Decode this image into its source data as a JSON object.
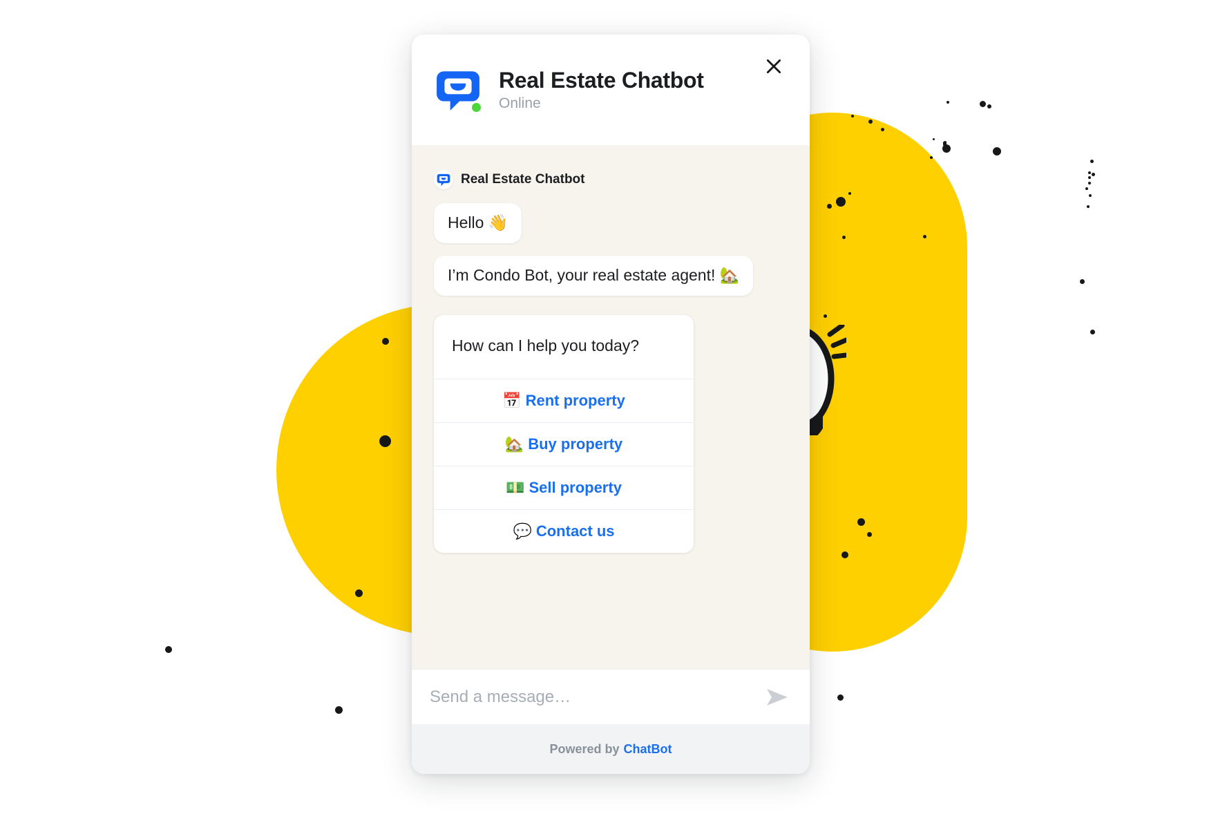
{
  "widget": {
    "header": {
      "title": "Real Estate Chatbot",
      "status": "Online",
      "avatar_icon": "chatbot-logo-icon",
      "close_icon": "close-icon",
      "online_indicator_color": "#4CD738"
    },
    "conversation": {
      "sender_name": "Real Estate Chatbot",
      "sender_avatar_icon": "chatbot-logo-icon",
      "messages": [
        {
          "text": "Hello 👋"
        },
        {
          "text": "I’m Condo Bot, your real estate agent! 🏡"
        }
      ],
      "card": {
        "question": "How can I help you today?",
        "options": [
          {
            "emoji": "📅",
            "label": "Rent property",
            "icon": "calendar-icon"
          },
          {
            "emoji": "🏡",
            "label": "Buy property",
            "icon": "house-with-garden-icon"
          },
          {
            "emoji": "💵",
            "label": "Sell property",
            "icon": "banknote-icon"
          },
          {
            "emoji": "💬",
            "label": "Contact us",
            "icon": "speech-balloon-icon"
          }
        ]
      }
    },
    "composer": {
      "placeholder": "Send a message…",
      "value": "",
      "send_icon": "send-icon"
    },
    "footer": {
      "powered_by": "Powered by",
      "brand": "ChatBot"
    }
  },
  "decor": {
    "accent_yellow": "#FFD000",
    "dot_color": "#17181A",
    "chat_bg": "#F7F4ED",
    "panel_bg": "#F2F3F5",
    "link_color": "#1A6FEE",
    "eyes_label": "cartoon-eyes-mascot"
  }
}
